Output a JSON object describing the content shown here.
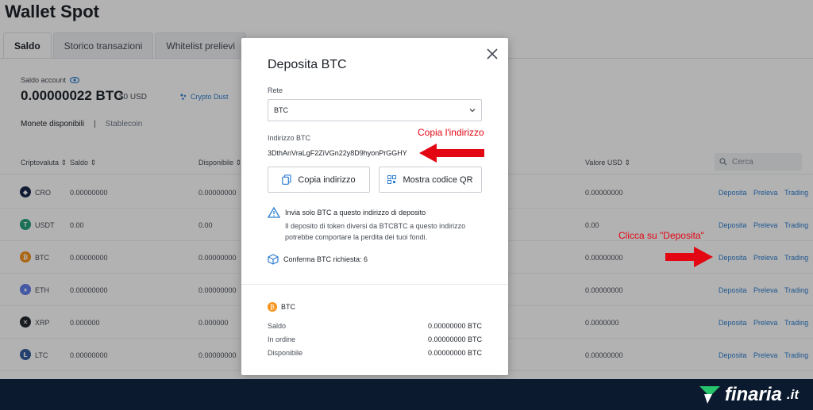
{
  "page": {
    "title": "Wallet Spot"
  },
  "tabs": [
    {
      "label": "Saldo",
      "active": true
    },
    {
      "label": "Storico transazioni",
      "active": false
    },
    {
      "label": "Whitelist prelievi",
      "active": false
    }
  ],
  "account": {
    "label": "Saldo account",
    "value": "0.00000022 BTC",
    "fiat": "$0 USD",
    "crypto_dust": "Crypto Dust"
  },
  "asset_tabs": {
    "active": "Monete disponibili",
    "other": "Stablecoin"
  },
  "table": {
    "headers": {
      "crypto": "Criptovaluta",
      "saldo": "Saldo",
      "disponibile": "Disponibile",
      "valore": "Valore USD"
    },
    "search_placeholder": "Cerca",
    "actions": {
      "deposita": "Deposita",
      "preleva": "Preleva",
      "trading": "Trading"
    },
    "rows": [
      {
        "symbol": "CRO",
        "saldo": "0.00000000",
        "disponibile": "0.00000000",
        "valore": "0.00000000",
        "color": "#1a2a4c"
      },
      {
        "symbol": "USDT",
        "saldo": "0.00",
        "disponibile": "0.00",
        "valore": "0.00",
        "color": "#26a17b"
      },
      {
        "symbol": "BTC",
        "saldo": "0.00000000",
        "disponibile": "0.00000000",
        "valore": "0.00000000",
        "color": "#f7931a"
      },
      {
        "symbol": "ETH",
        "saldo": "0.00000000",
        "disponibile": "0.00000000",
        "valore": "0.00000000",
        "color": "#627eea"
      },
      {
        "symbol": "XRP",
        "saldo": "0.000000",
        "disponibile": "0.000000",
        "valore": "0.0000000",
        "color": "#23292f"
      },
      {
        "symbol": "LTC",
        "saldo": "0.00000000",
        "disponibile": "0.00000000",
        "valore": "0.00000000",
        "color": "#345d9d"
      }
    ]
  },
  "modal": {
    "title": "Deposita BTC",
    "network_label": "Rete",
    "network_value": "BTC",
    "address_label": "Indirizzo BTC",
    "address_value": "3DthAnVraLgF2ZiVGn22y8D9hyonPrGGHY",
    "copy_button": "Copia indirizzo",
    "qr_button": "Mostra codice QR",
    "warning_title": "Invia solo BTC a questo indirizzo di deposito",
    "warning_body": "Il deposito di token diversi da BTCBTC a questo indirizzo potrebbe comportare la perdita dei tuoi fondi.",
    "confirm_text": "Conferma BTC richiesta: 6",
    "coin": "BTC",
    "summary": [
      {
        "label": "Saldo",
        "value": "0.00000000 BTC"
      },
      {
        "label": "In ordine",
        "value": "0.00000000 BTC"
      },
      {
        "label": "Disponibile",
        "value": "0.00000000 BTC"
      }
    ]
  },
  "annotations": {
    "copy_address": "Copia l'indirizzo",
    "click_deposit": "Clicca su \"Deposita\""
  },
  "colors": {
    "annotation": "#e30613",
    "link": "#2f7fd0",
    "footer_bg": "#0b1a2e",
    "brand_green": "#27c46b"
  },
  "brand": {
    "name": "finaria",
    "tld": ".it"
  }
}
